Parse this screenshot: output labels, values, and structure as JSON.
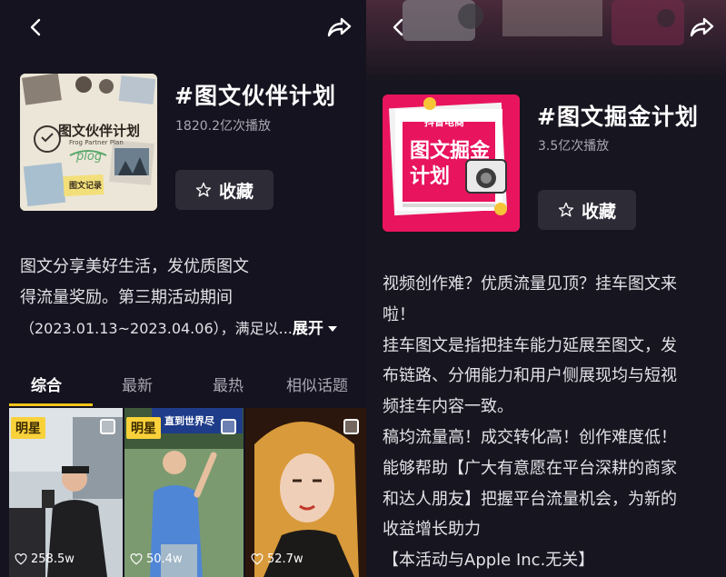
{
  "left": {
    "title": "#图文伙伴计划",
    "plays": "1820.2亿次播放",
    "favorite_label": "收藏",
    "cover": {
      "brand_text": "图文伙伴计划",
      "brand_sub": "Frog Partner Plan",
      "tag_text": "图文记录",
      "script_text": "plog"
    },
    "description": [
      "图文分享美好生活，发优质图文",
      "得流量奖励。第三期活动期间",
      "（2023.01.13~2023.04.06），满足以..."
    ],
    "expand_label": "展开",
    "tabs": [
      "综合",
      "最新",
      "最热",
      "相似话题"
    ],
    "active_tab": 0,
    "videos": [
      {
        "badge": "明星",
        "likes": "258.5w"
      },
      {
        "badge": "明星",
        "likes": "50.4w",
        "sign_text": "直到世界尽"
      },
      {
        "badge": "",
        "likes": "52.7w"
      }
    ]
  },
  "right": {
    "title": "#图文掘金计划",
    "plays": "3.5亿次播放",
    "favorite_label": "收藏",
    "cover": {
      "brand_text": "抖音电商",
      "main_line1": "图文掘金",
      "main_line2": "计划"
    },
    "description": [
      "视频创作难？优质流量见顶？挂车图文来",
      "啦！",
      "挂车图文是指把挂车能力延展至图文，发",
      "布链路、分佣能力和用户侧展现均与短视",
      "频挂车内容一致。",
      "稿均流量高！成交转化高！创作难度低！",
      "能够帮助【广大有意愿在平台深耕的商家",
      "和达人朋友】把握平台流量机会，为新的",
      "收益增长助力",
      "【本活动与Apple Inc.无关】"
    ]
  },
  "icons": [
    "back-arrow-icon",
    "share-icon",
    "star-icon",
    "heart-icon",
    "caret-down-icon"
  ],
  "colors": {
    "background": "#15131f",
    "accent_underline": "#f5c518",
    "badge": "#f9d13a",
    "right_cover": "#e8145e"
  }
}
